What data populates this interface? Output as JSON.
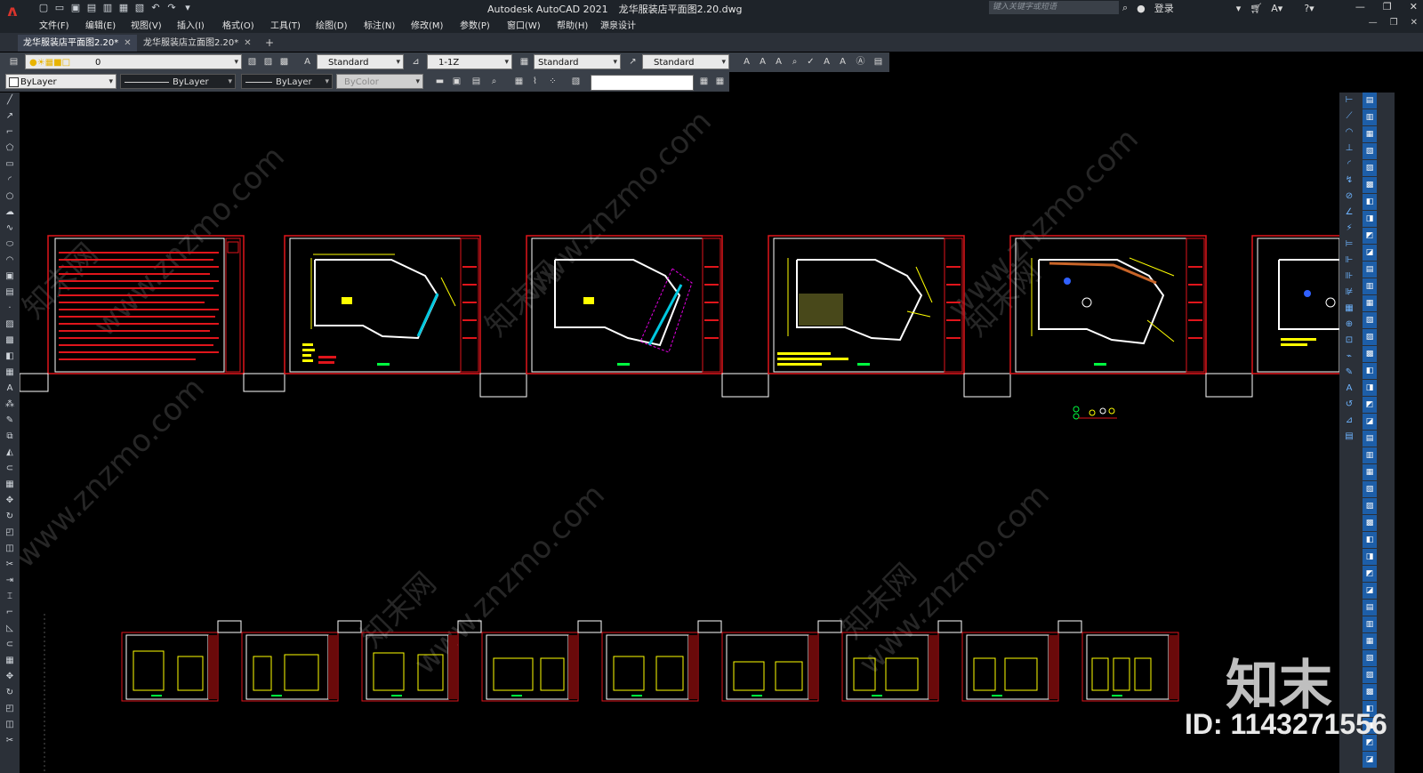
{
  "app": {
    "name": "Autodesk AutoCAD 2021",
    "filename": "龙华服装店平面图2.20.dwg",
    "search_placeholder": "键入关键字或短语",
    "login": "登录",
    "logo": "A"
  },
  "menu": [
    "文件(F)",
    "编辑(E)",
    "视图(V)",
    "插入(I)",
    "格式(O)",
    "工具(T)",
    "绘图(D)",
    "标注(N)",
    "修改(M)",
    "参数(P)",
    "窗口(W)",
    "帮助(H)",
    "源泉设计"
  ],
  "tabs": [
    {
      "label": "龙华服装店平面图2.20*",
      "active": true
    },
    {
      "label": "龙华服装店立面图2.20*",
      "active": false
    }
  ],
  "toolbar1": {
    "layer": "0",
    "text_style": "Standard",
    "dim_style": "1-1Z",
    "table_style": "Standard",
    "mleader_style": "Standard"
  },
  "toolbar2": {
    "color": "ByLayer",
    "linetype": "ByLayer",
    "lineweight": "ByLayer",
    "plotstyle": "ByColor"
  },
  "watermark": {
    "logo": "知末",
    "id_text": "ID: 1143271556",
    "url_text": "www.znzmo.com",
    "site_text": "知末网"
  },
  "colors": {
    "title_bg": "#1e2329",
    "toolbar_bg": "#3a4049",
    "canvas_bg": "#000000",
    "frame_red": "#e0151b",
    "cad_yellow": "#ffff00"
  }
}
